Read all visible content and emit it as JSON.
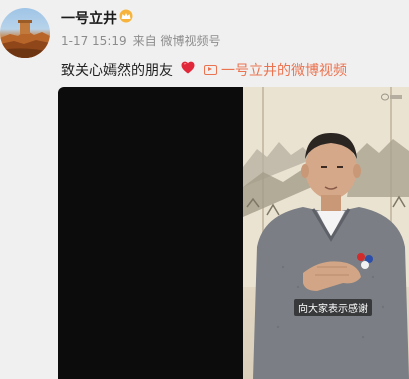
{
  "post": {
    "author": "一号立井",
    "author_badge": "crown-icon",
    "date": "1-17 15:19",
    "source": "来自 微博视频号",
    "text": "致关心嫣然的朋友",
    "text_emoji": "heart-icon",
    "video_link_label": "一号立井的微博视频",
    "video": {
      "caption": "向大家表示感谢"
    }
  },
  "colors": {
    "link": "#eb7350",
    "heart": "#e0283a",
    "meta": "#8c8c8c"
  }
}
